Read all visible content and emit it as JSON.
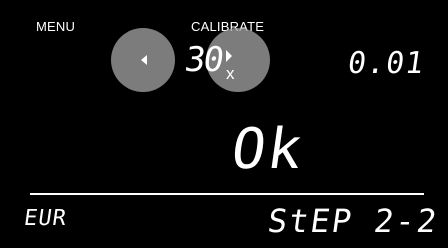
{
  "header": {
    "menu_label": "MENU",
    "calibrate_label": "CALIBRATE"
  },
  "multiplier": {
    "value": "30",
    "suffix": "x"
  },
  "resolution": "0.01",
  "status": "Ok",
  "units": "EUR",
  "step": "StEP 2-2",
  "colors": {
    "background": "#000000",
    "foreground": "#ffffff",
    "button_fill": "#a5a5a5"
  }
}
